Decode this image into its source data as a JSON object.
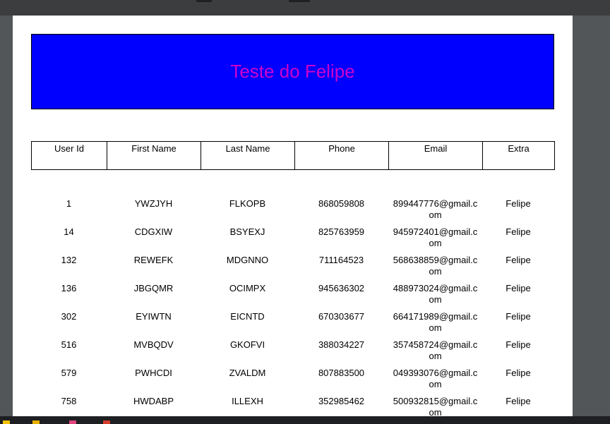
{
  "banner": {
    "title": "Teste do Felipe"
  },
  "table": {
    "columns": [
      "User Id",
      "First Name",
      "Last Name",
      "Phone",
      "Email",
      "Extra"
    ],
    "rows": [
      [
        "1",
        "YWZJYH",
        "FLKOPB",
        "868059808",
        "899447776@gmail.com",
        "Felipe"
      ],
      [
        "14",
        "CDGXIW",
        "BSYEXJ",
        "825763959",
        "945972401@gmail.com",
        "Felipe"
      ],
      [
        "132",
        "REWEFK",
        "MDGNNO",
        "711164523",
        "568638859@gmail.com",
        "Felipe"
      ],
      [
        "136",
        "JBGQMR",
        "OCIMPX",
        "945636302",
        "488973024@gmail.com",
        "Felipe"
      ],
      [
        "302",
        "EYIWTN",
        "EICNTD",
        "670303677",
        "664171989@gmail.com",
        "Felipe"
      ],
      [
        "516",
        "MVBQDV",
        "GKOFVI",
        "388034227",
        "357458724@gmail.com",
        "Felipe"
      ],
      [
        "579",
        "PWHCDI",
        "ZVALDM",
        "807883500",
        "049393076@gmail.com",
        "Felipe"
      ],
      [
        "758",
        "HWDABP",
        "ILLEXH",
        "352985462",
        "500932815@gmail.com",
        "Felipe"
      ]
    ]
  },
  "colors": {
    "banner_bg": "#0000ff",
    "banner_text": "#cc00cc",
    "viewer_bg": "#525659"
  }
}
